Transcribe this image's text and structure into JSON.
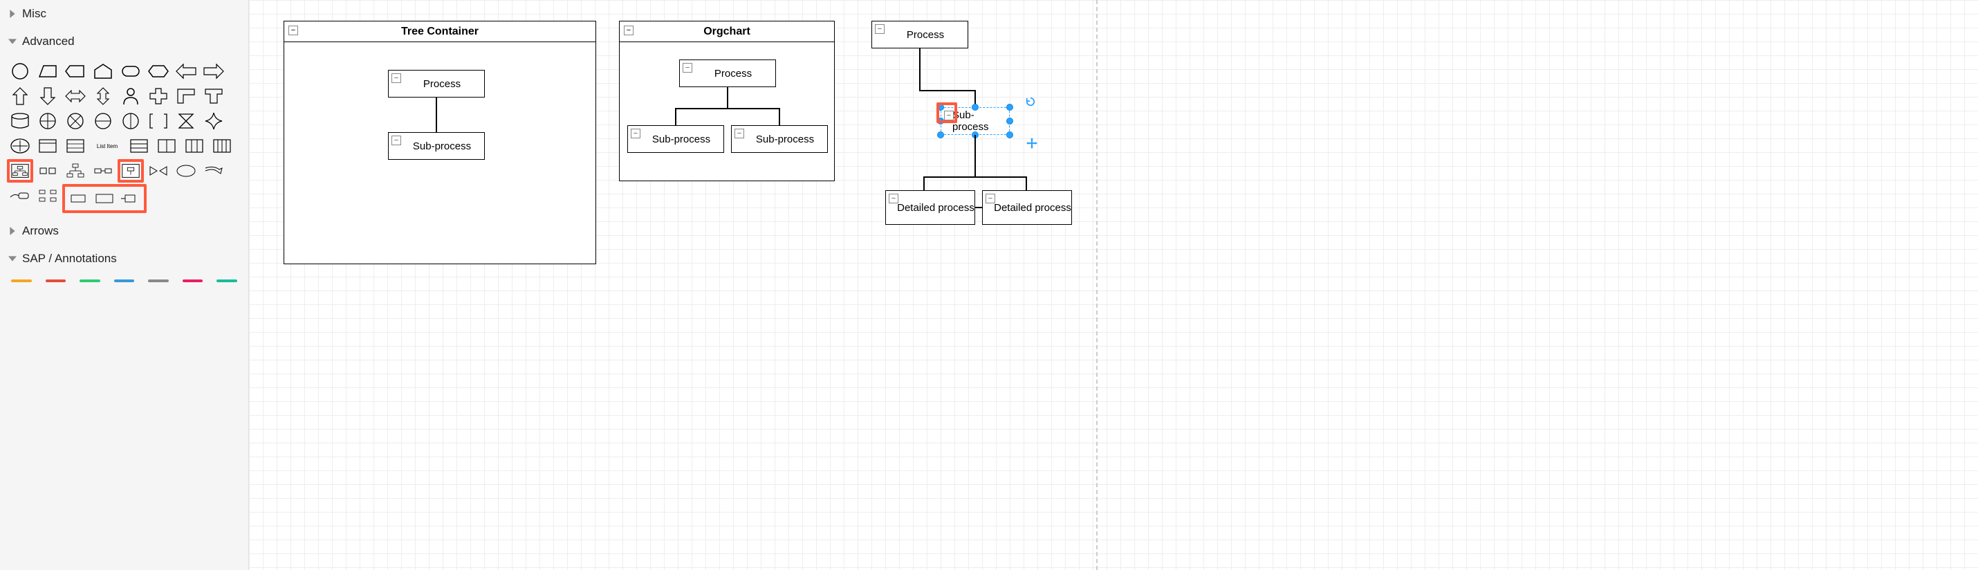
{
  "sidebar": {
    "sections": {
      "misc": {
        "label": "Misc",
        "expanded": false
      },
      "advanced": {
        "label": "Advanced",
        "expanded": true
      },
      "arrows": {
        "label": "Arrows",
        "expanded": false
      },
      "sap": {
        "label": "SAP / Annotations",
        "expanded": true
      }
    },
    "listitem_label": "List Item",
    "annotation_colors": [
      "#f5a623",
      "#e74c3c",
      "#2ecc71",
      "#3498db",
      "#888",
      "#e91e63",
      "#1abc9c"
    ]
  },
  "canvas": {
    "containers": [
      {
        "id": "tree",
        "title": "Tree Container"
      },
      {
        "id": "org",
        "title": "Orgchart"
      }
    ],
    "tree_nodes": {
      "process": "Process",
      "subprocess": "Sub-process"
    },
    "org_nodes": {
      "process": "Process",
      "subprocess1": "Sub-process",
      "subprocess2": "Sub-process"
    },
    "free_nodes": {
      "process": "Process",
      "subprocess": "Sub-process",
      "detailed1": "Detailed process",
      "detailed2": "Detailed process"
    }
  }
}
